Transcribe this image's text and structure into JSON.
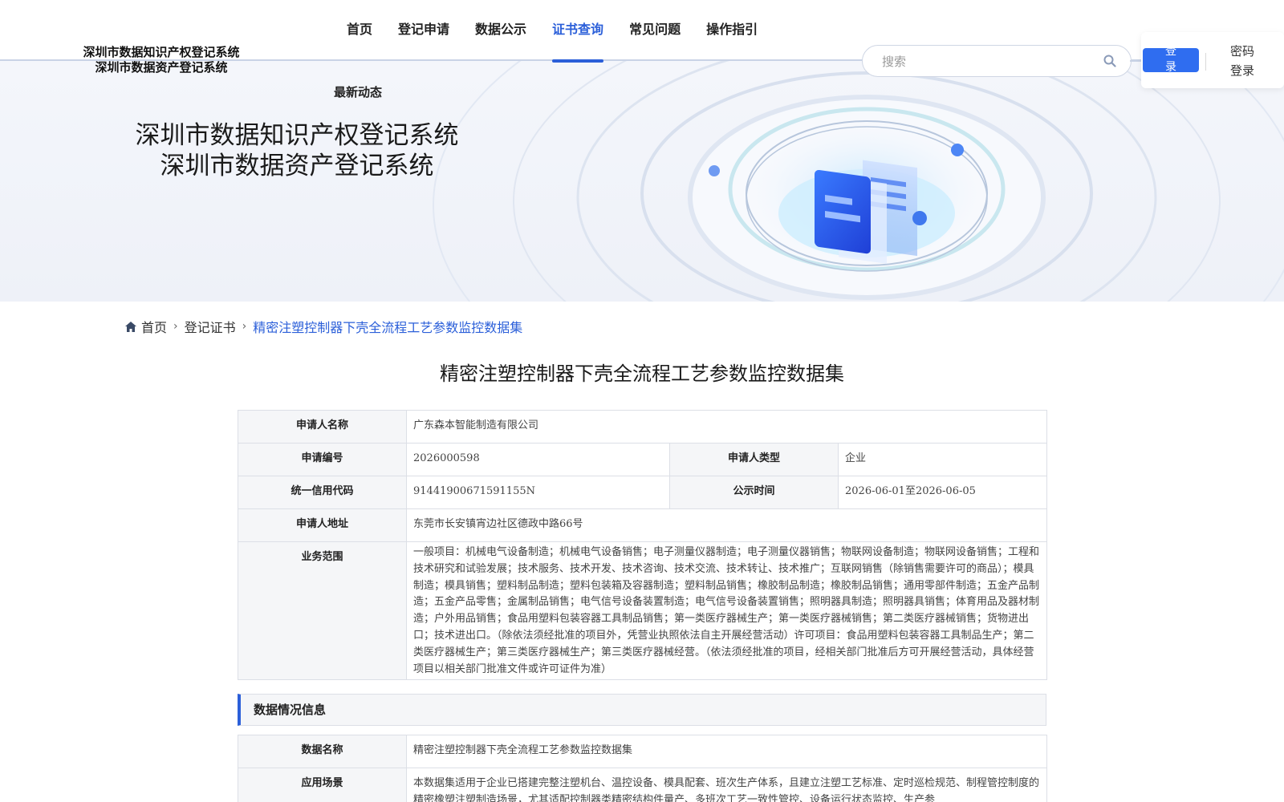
{
  "header": {
    "logo_line1": "深圳市数据知识产权登记系统",
    "logo_line2": "深圳市数据资产登记系统",
    "nav": [
      {
        "label": "首页",
        "active": false
      },
      {
        "label": "登记申请",
        "active": false
      },
      {
        "label": "数据公示",
        "active": false
      },
      {
        "label": "证书查询",
        "active": true
      },
      {
        "label": "常见问题",
        "active": false
      },
      {
        "label": "操作指引",
        "active": false
      }
    ],
    "nav_sub": "最新动态",
    "search_placeholder": "搜索",
    "search_icon": "search-icon",
    "login_label": "登录",
    "password_login_label": "密码登录",
    "accent_color": "#2b5fd9",
    "login_button_color": "#2f6df0"
  },
  "banner": {
    "title_line1": "深圳市数据知识产权登记系统",
    "title_line2": "深圳市数据资产登记系统"
  },
  "breadcrumb": {
    "home_icon": "home-icon",
    "home": "首页",
    "level2": "登记证书",
    "current": "精密注塑控制器下壳全流程工艺参数监控数据集"
  },
  "page_title": "精密注塑控制器下壳全流程工艺参数监控数据集",
  "applicant": {
    "name_label": "申请人名称",
    "name": "广东森本智能制造有限公司",
    "number_label": "申请编号",
    "number": "2026000598",
    "type_label": "申请人类型",
    "type": "企业",
    "credit_code_label": "统一信用代码",
    "credit_code": "91441900671591155N",
    "publicity_label": "公示时间",
    "publicity": "2026-06-01至2026-06-05",
    "address_label": "申请人地址",
    "address": "东莞市长安镇宵边社区德政中路66号",
    "scope_label": "业务范围",
    "scope": "一般项目：机械电气设备制造；机械电气设备销售；电子测量仪器制造；电子测量仪器销售；物联网设备制造；物联网设备销售；工程和技术研究和试验发展；技术服务、技术开发、技术咨询、技术交流、技术转让、技术推广；互联网销售（除销售需要许可的商品）；模具制造；模具销售；塑料制品制造；塑料包装箱及容器制造；塑料制品销售；橡胶制品制造；橡胶制品销售；通用零部件制造；五金产品制造；五金产品零售；金属制品销售；电气信号设备装置制造；电气信号设备装置销售；照明器具制造；照明器具销售；体育用品及器材制造；户外用品销售；食品用塑料包装容器工具制品销售；第一类医疗器械生产；第一类医疗器械销售；第二类医疗器械销售；货物进出口；技术进出口。（除依法须经批准的项目外，凭营业执照依法自主开展经营活动）许可项目：食品用塑料包装容器工具制品生产；第二类医疗器械生产；第三类医疗器械生产；第三类医疗器械经营。（依法须经批准的项目，经相关部门批准后方可开展经营活动，具体经营项目以相关部门批准文件或许可证件为准）"
  },
  "data_section": {
    "header": "数据情况信息",
    "name_label": "数据名称",
    "name": "精密注塑控制器下壳全流程工艺参数监控数据集",
    "scenario_label": "应用场景",
    "scenario": "本数据集适用于企业已搭建完整注塑机台、温控设备、模具配套、班次生产体系，且建立注塑工艺标准、定时巡检规范、制程管控制度的精密橡塑注塑制造场景，尤其适配控制器类精密结构件量产、多班次工艺一致性管控、设备运行状态监控、生产参"
  }
}
